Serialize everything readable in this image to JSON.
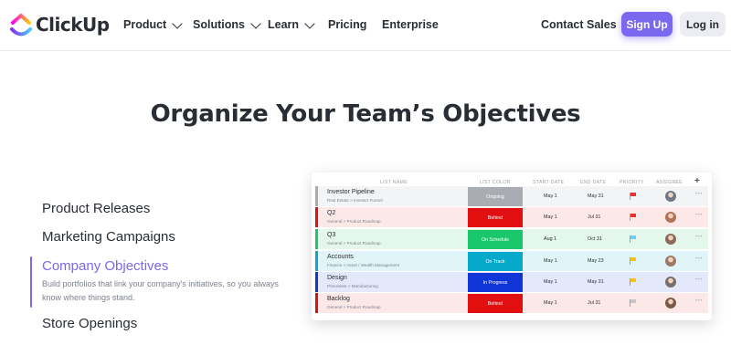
{
  "brand": {
    "name": "ClickUp"
  },
  "nav": {
    "items": [
      {
        "label": "Product",
        "has_dropdown": true
      },
      {
        "label": "Solutions",
        "has_dropdown": true
      },
      {
        "label": "Learn",
        "has_dropdown": true
      },
      {
        "label": "Pricing",
        "has_dropdown": false
      },
      {
        "label": "Enterprise",
        "has_dropdown": false
      }
    ],
    "contact_sales": "Contact Sales",
    "sign_up": "Sign Up",
    "log_in": "Log in"
  },
  "hero": {
    "headline": "Organize Your Team’s Objectives"
  },
  "features": {
    "items": [
      {
        "label": "Product Releases",
        "active": false
      },
      {
        "label": "Marketing Campaigns",
        "active": false
      },
      {
        "label": "Company Objectives",
        "active": true
      },
      {
        "label": "Store Openings",
        "active": false
      }
    ],
    "active_description": "Build portfolios that link your company's initiatives, so you always know where things stand."
  },
  "table": {
    "headers": {
      "list_name": "LIST NAME",
      "list_color": "LIST COLOR",
      "start_date": "START DATE",
      "end_date": "END DATE",
      "priority": "PRIORITY",
      "assignee": "ASSIGNEE",
      "add": "+"
    },
    "rows": [
      {
        "name": "Investor Pipeline",
        "path": "Real Estate > Investor Funnel",
        "status": "Ongoing",
        "status_color": "#a9adb3",
        "row_bg": "#f3f4f6",
        "stripe": "#a9adb3",
        "start": "May 1",
        "end": "May 31",
        "priority": "red",
        "priority_color": "#e5322d",
        "avatar_color": "#6f7885",
        "more": "•••"
      },
      {
        "name": "Q2",
        "path": "General > Product Roadmap",
        "status": "Behind",
        "status_color": "#e20f10",
        "row_bg": "#fde8e8",
        "stripe": "#e20f10",
        "start": "May 1",
        "end": "Jul 31",
        "priority": "red",
        "priority_color": "#e5322d",
        "avatar_color": "#b07258",
        "more": "•••"
      },
      {
        "name": "Q3",
        "path": "General > Product Roadmap",
        "status": "On Schedule",
        "status_color": "#1bc76c",
        "row_bg": "#e4f7ec",
        "stripe": "#1bc76c",
        "start": "Aug 1",
        "end": "Oct 31",
        "priority": "light-blue",
        "priority_color": "#6fcdf0",
        "avatar_color": "#8a6b5a",
        "more": "•••"
      },
      {
        "name": "Accounts",
        "path": "Finance > Asset / Wealth Management",
        "status": "On Track",
        "status_color": "#06a9c9",
        "row_bg": "#e1f4f8",
        "stripe": "#06a9c9",
        "start": "May 1",
        "end": "May 23",
        "priority": "yellow",
        "priority_color": "#f5c11b",
        "avatar_color": "#9c7a66",
        "more": "•••"
      },
      {
        "name": "Design",
        "path": "Processes > Manufacturing",
        "status": "In Progress",
        "status_color": "#0f35d6",
        "row_bg": "#e3e8fb",
        "stripe": "#0f35d6",
        "start": "May 1",
        "end": "May 31",
        "priority": "yellow",
        "priority_color": "#f5c11b",
        "avatar_color": "#7a6e68",
        "more": "•••"
      },
      {
        "name": "Backlog",
        "path": "General > Product Roadmap",
        "status": "Behind",
        "status_color": "#e20f10",
        "row_bg": "#fde8e8",
        "stripe": "#e20f10",
        "start": "May 1",
        "end": "Jul 31",
        "priority": "gray",
        "priority_color": "#c4c7cc",
        "avatar_color": "#7d5a48",
        "more": "•••"
      }
    ]
  },
  "colors": {
    "accent": "#7b68ee",
    "text": "#292d34",
    "muted": "#7c828d"
  }
}
